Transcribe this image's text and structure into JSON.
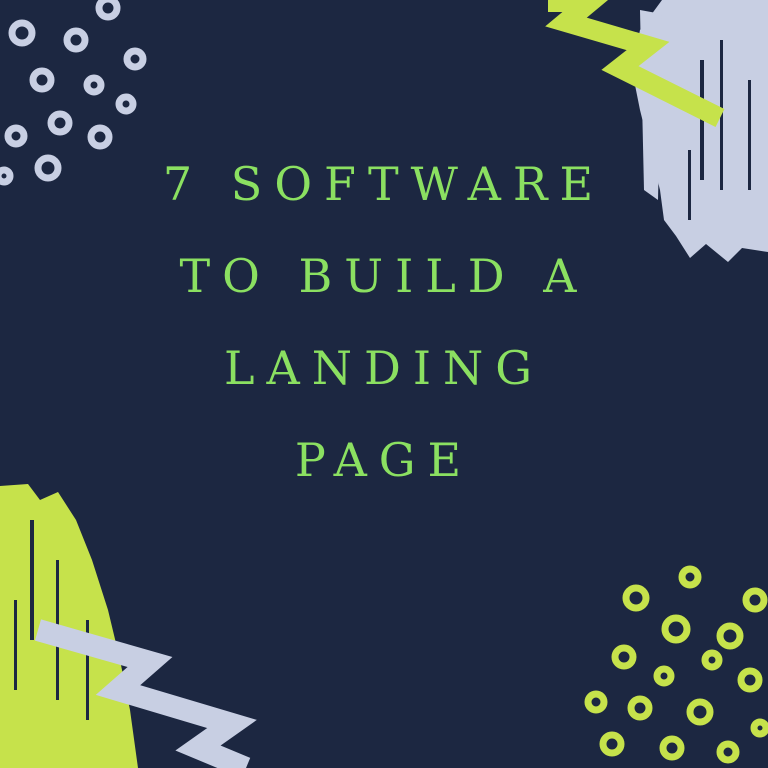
{
  "title_lines": [
    "7 SOFTWARE",
    "TO BUILD A",
    "LANDING",
    "PAGE"
  ],
  "colors": {
    "background": "#1c2741",
    "title_text": "#8be061",
    "lime_accent": "#c6e24b",
    "lavender_accent": "#c8cfe3"
  },
  "decorations": [
    "dot-cluster-top-left",
    "paint-stroke-top-right",
    "zigzag-top-right",
    "paint-stroke-bottom-left",
    "zigzag-bottom-left",
    "dot-cluster-bottom-right"
  ]
}
